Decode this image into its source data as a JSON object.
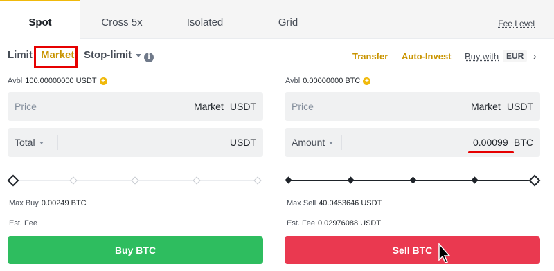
{
  "tabs": [
    {
      "label": "Spot"
    },
    {
      "label": "Cross 5x"
    },
    {
      "label": "Isolated"
    },
    {
      "label": "Grid"
    }
  ],
  "fee_level": "Fee Level",
  "order_types": {
    "limit": "Limit",
    "market": "Market",
    "stop_limit": "Stop-limit"
  },
  "top_links": {
    "transfer": "Transfer",
    "auto_invest": "Auto-Invest",
    "buy_with": "Buy with",
    "currency": "EUR"
  },
  "buy": {
    "avbl_label": "Avbl",
    "avbl_value": "100.00000000 USDT",
    "price_label": "Price",
    "price_value": "Market",
    "price_unit": "USDT",
    "total_label": "Total",
    "total_unit": "USDT",
    "max_label": "Max Buy",
    "max_value": "0.00249 BTC",
    "fee_label": "Est. Fee",
    "button": "Buy BTC"
  },
  "sell": {
    "avbl_label": "Avbl",
    "avbl_value": "0.00000000 BTC",
    "price_label": "Price",
    "price_value": "Market",
    "price_unit": "USDT",
    "amount_label": "Amount",
    "amount_value": "0.00099",
    "amount_unit": "BTC",
    "max_label": "Max Sell",
    "max_value": "40.0453646 USDT",
    "fee_label": "Est. Fee",
    "fee_value": "0.02976088 USDT",
    "button": "Sell BTC",
    "slider_percent": 100
  },
  "colors": {
    "accent": "#f0b90b",
    "buy": "#2ebd5f",
    "sell": "#ea3950",
    "highlight": "#e60000"
  }
}
